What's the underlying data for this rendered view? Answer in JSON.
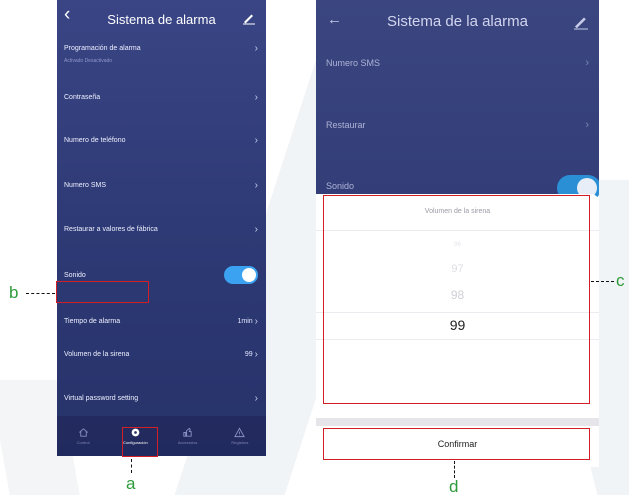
{
  "left_screen": {
    "title": "Sistema de alarma",
    "items": [
      {
        "label": "Programación de alarma",
        "sub": "Activado Desactivado"
      },
      {
        "label": "Contraseña"
      },
      {
        "label": "Numero de teléfono"
      },
      {
        "label": "Numero SMS"
      },
      {
        "label": "Restaurar a valores de fábrica"
      },
      {
        "label": "Sonido"
      },
      {
        "label": "Tiempo de alarma",
        "value": "1min"
      },
      {
        "label": "Volumen de la sirena",
        "value": "99"
      },
      {
        "label": "Virtual password setting"
      }
    ],
    "nav": [
      {
        "label": "Control",
        "icon": "home-icon"
      },
      {
        "label": "Configuración",
        "icon": "gear-icon"
      },
      {
        "label": "Accesorios",
        "icon": "accessory-icon"
      },
      {
        "label": "Registros",
        "icon": "warning-icon"
      }
    ]
  },
  "right_screen": {
    "title": "Sistema de la alarma",
    "items": [
      {
        "label": "Numero SMS"
      },
      {
        "label": "Restaurar"
      },
      {
        "label": "Sonido"
      }
    ],
    "picker": {
      "title": "Volumen de la sirena",
      "values": [
        "96",
        "97",
        "98",
        "99"
      ],
      "selected": "99"
    },
    "confirm_label": "Confirmar"
  },
  "callouts": {
    "a": "a",
    "b": "b",
    "c": "c",
    "d": "d"
  },
  "colors": {
    "highlight": "#d21f26",
    "callout_text": "#2e9b3b",
    "toggle_on": "#3aa2f0",
    "header_bg": "#3a4585"
  }
}
